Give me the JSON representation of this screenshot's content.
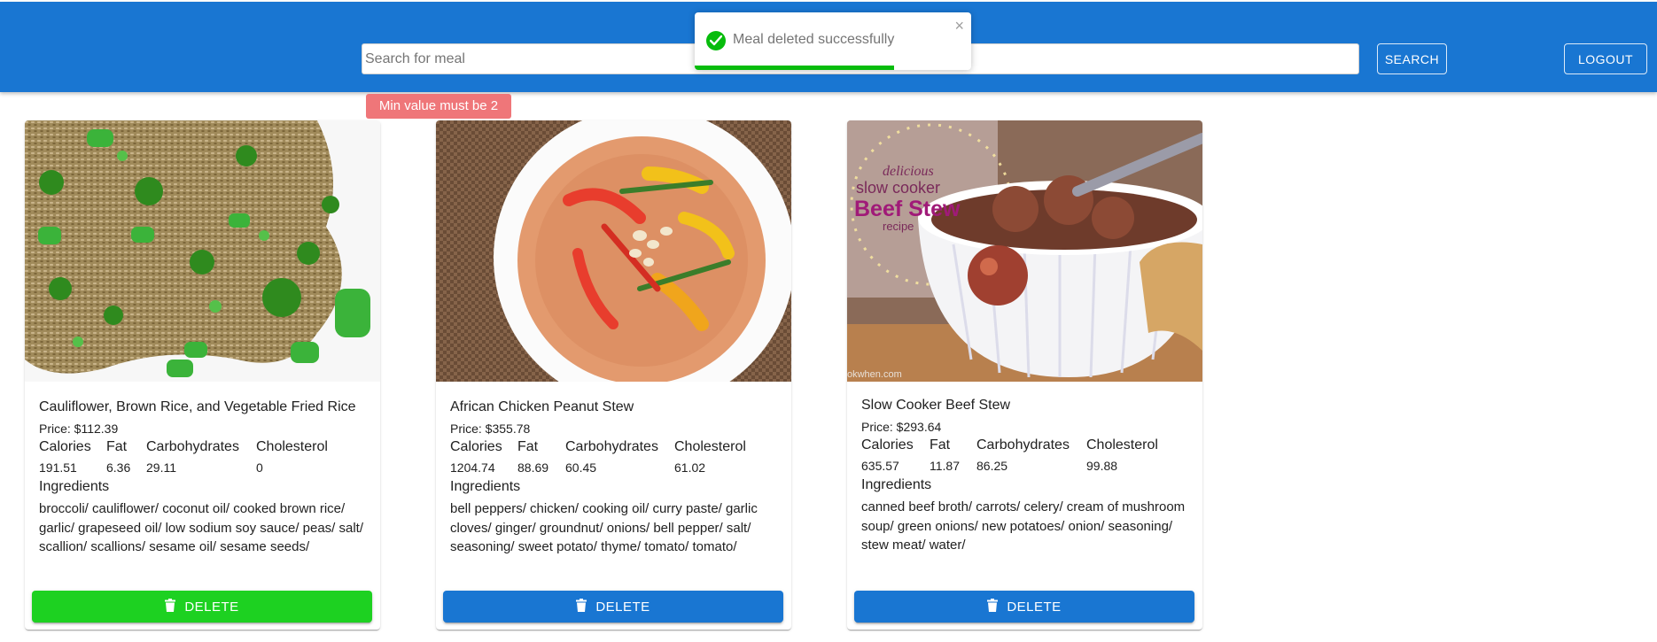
{
  "header": {
    "search_placeholder": "Search for meal",
    "search_label": "SEARCH",
    "logout_label": "LOGOUT",
    "bg_color": "#1976d2"
  },
  "toast": {
    "message": "Meal deleted successfully",
    "close_glyph": "×",
    "progress": 0.72,
    "color": "#07bc0c"
  },
  "validation": {
    "message": "Min value must be 2"
  },
  "nutrition_headers": {
    "calories": "Calories",
    "fat": "Fat",
    "carbohydrates": "Carbohydrates",
    "cholesterol": "Cholesterol"
  },
  "ingredients_label": "Ingredients",
  "meals": [
    {
      "title": "Cauliflower, Brown Rice, and Vegetable Fried Rice",
      "price": "Price: $112.39",
      "calories": "191.51",
      "fat": "6.36",
      "carbohydrates": "29.11",
      "cholesterol": "0",
      "ingredients": "broccoli/ cauliflower/ coconut oil/ cooked brown rice/ garlic/ grapeseed oil/ low sodium soy sauce/ peas/ salt/ scallion/ scallions/ sesame oil/ sesame seeds/",
      "delete_label": "DELETE",
      "delete_color": "#1dd121"
    },
    {
      "title": "African Chicken Peanut Stew",
      "price": "Price: $355.78",
      "calories": "1204.74",
      "fat": "88.69",
      "carbohydrates": "60.45",
      "cholesterol": "61.02",
      "ingredients": "bell peppers/ chicken/ cooking oil/ curry paste/ garlic cloves/ ginger/ groundnut/ onions/ bell pepper/ salt/ seasoning/ sweet potato/ thyme/ tomato/ tomato/",
      "delete_label": "DELETE",
      "delete_color": "#1976d2"
    },
    {
      "title": "Slow Cooker Beef Stew",
      "price": "Price: $293.64",
      "calories": "635.57",
      "fat": "11.87",
      "carbohydrates": "86.25",
      "cholesterol": "99.88",
      "ingredients": "canned beef broth/ carrots/ celery/ cream of mushroom soup/ green onions/ new potatoes/ onion/ seasoning/ stew meat/ water/",
      "delete_label": "DELETE",
      "delete_color": "#1976d2",
      "image_overlay": {
        "line1": "delicious",
        "line2": "slow cooker",
        "line3": "Beef Stew",
        "line4": "recipe",
        "watermark": "okwhen.com"
      }
    }
  ]
}
